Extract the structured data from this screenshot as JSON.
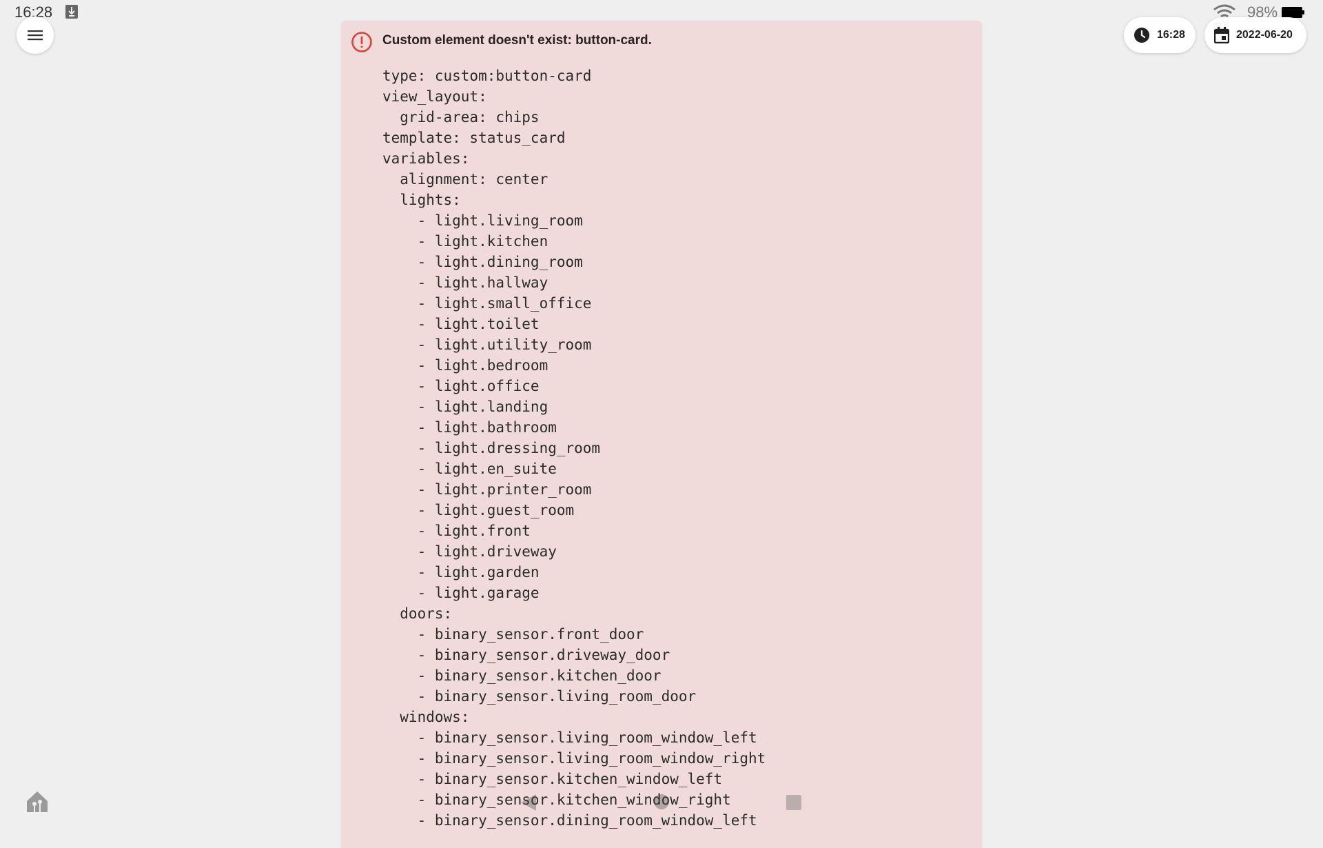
{
  "status_bar": {
    "time": "16:28",
    "battery": "98%"
  },
  "chips": {
    "time": "16:28",
    "date": "2022-06-20"
  },
  "error": {
    "title": "Custom element doesn't exist: button-card.",
    "yaml_lines": [
      "type: custom:button-card",
      "view_layout:",
      "  grid-area: chips",
      "template: status_card",
      "variables:",
      "  alignment: center",
      "  lights:",
      "    - light.living_room",
      "    - light.kitchen",
      "    - light.dining_room",
      "    - light.hallway",
      "    - light.small_office",
      "    - light.toilet",
      "    - light.utility_room",
      "    - light.bedroom",
      "    - light.office",
      "    - light.landing",
      "    - light.bathroom",
      "    - light.dressing_room",
      "    - light.en_suite",
      "    - light.printer_room",
      "    - light.guest_room",
      "    - light.front",
      "    - light.driveway",
      "    - light.garden",
      "    - light.garage",
      "  doors:",
      "    - binary_sensor.front_door",
      "    - binary_sensor.driveway_door",
      "    - binary_sensor.kitchen_door",
      "    - binary_sensor.living_room_door",
      "  windows:",
      "    - binary_sensor.living_room_window_left",
      "    - binary_sensor.living_room_window_right",
      "    - binary_sensor.kitchen_window_left",
      "    - binary_sensor.kitchen_window_right",
      "    - binary_sensor.dining_room_window_left"
    ]
  },
  "colors": {
    "error_background": "#f1dada",
    "error_icon": "#db4437",
    "page_background": "#efefef"
  },
  "icons": {
    "menu": "hamburger-menu-icon",
    "clock": "clock-icon",
    "calendar": "calendar-icon",
    "error": "alert-circle-icon",
    "home": "home-assistant-icon"
  }
}
